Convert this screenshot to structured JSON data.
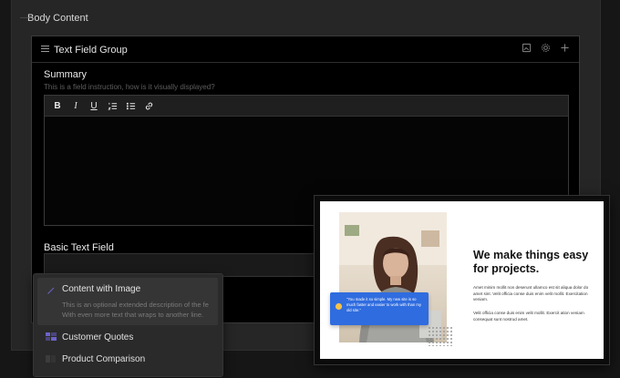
{
  "body_content": {
    "title": "Body Content"
  },
  "group": {
    "title": "Text Field Group",
    "summary": {
      "label": "Summary",
      "help": "This is a field instruction, how is it visually displayed?",
      "toolbar": {
        "bold": "B",
        "italic": "I",
        "underline": "U"
      }
    },
    "basic": {
      "label": "Basic Text Field",
      "value": ""
    }
  },
  "popup": {
    "items": [
      {
        "title": "Content with Image",
        "description_line1": "This is an optional extended description of the fe",
        "description_line2": "With even more text that wraps to another line.",
        "icon": "pen-icon"
      },
      {
        "title": "Customer Quotes",
        "icon": "quote-blocks-icon"
      },
      {
        "title": "Product Comparison",
        "icon": "comparison-icon"
      }
    ]
  },
  "preview": {
    "heading": "We make things easy for projects.",
    "paragraph1": "Amet minim mollit non deserunt ullamco est sit aliqua dolor do amet sint. Velit officia conse duis enim velit mollit. Exercitation veniam.",
    "paragraph2": "Velit officia conse duis enim velit mollit. Exercit ation veniam consequat sunt nostrud amet.",
    "quote": "\"You made it so simple. My new site is so much faster and easier to work with than my old site.\"",
    "accent_color": "#2f6cdf"
  }
}
